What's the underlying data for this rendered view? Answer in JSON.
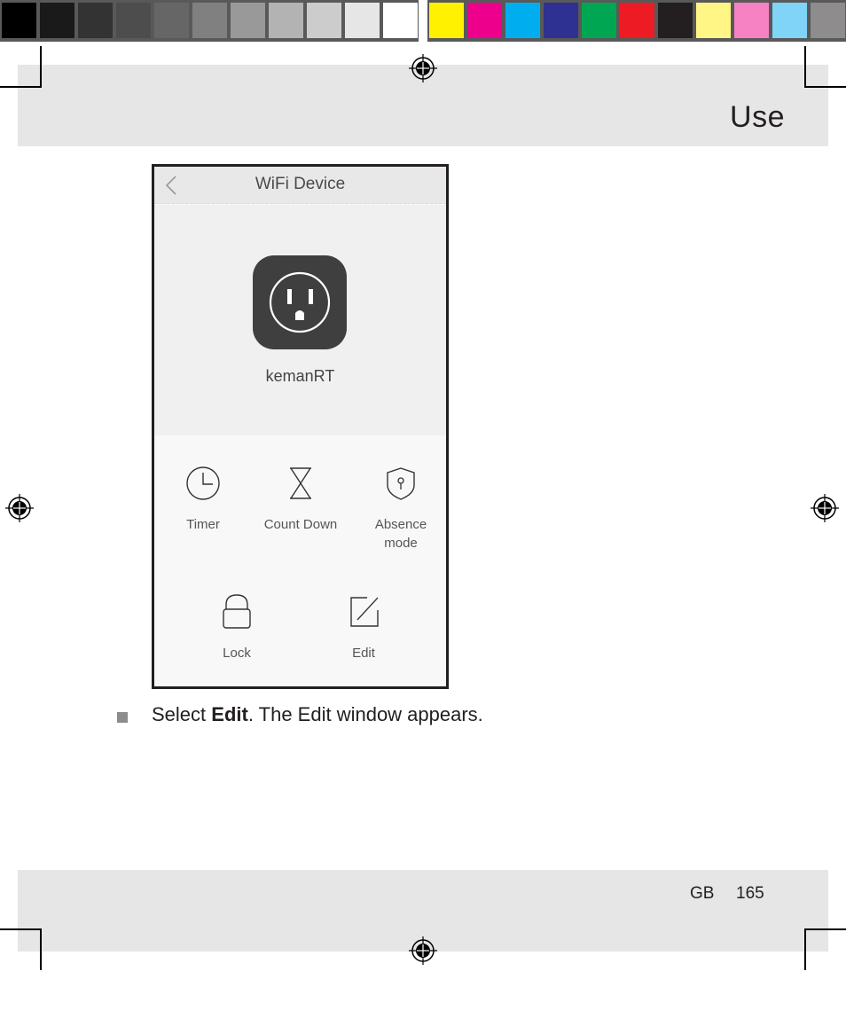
{
  "calibration_bar": {
    "grayscale": [
      "#000000",
      "#1a1a1a",
      "#333333",
      "#4d4d4d",
      "#666666",
      "#808080",
      "#999999",
      "#b3b3b3",
      "#cccccc",
      "#e6e6e6",
      "#ffffff"
    ],
    "colors": [
      "#fff100",
      "#ec008c",
      "#00aeef",
      "#2e3192",
      "#00a651",
      "#ed1c24",
      "#231f20",
      "#fff685",
      "#f682c4",
      "#7fd4f7",
      "#8e8c8d"
    ]
  },
  "header": {
    "section_title": "Use"
  },
  "phone": {
    "title": "WiFi Device",
    "back_icon": "chevron-left-icon",
    "device_icon": "power-outlet-icon",
    "device_name": "kemanRT",
    "functions": [
      {
        "label": "Timer",
        "icon": "clock-icon"
      },
      {
        "label": "Count Down",
        "icon": "hourglass-icon"
      },
      {
        "label_line1": "Absence",
        "label_line2": "mode",
        "icon": "shield-icon"
      },
      {
        "label": "Lock",
        "icon": "lock-icon"
      },
      {
        "label": "Edit",
        "icon": "edit-icon"
      }
    ]
  },
  "instruction": {
    "prefix": "Select ",
    "bold": "Edit",
    "suffix": ". The Edit window appears."
  },
  "footer": {
    "language": "GB",
    "page_number": "165"
  }
}
